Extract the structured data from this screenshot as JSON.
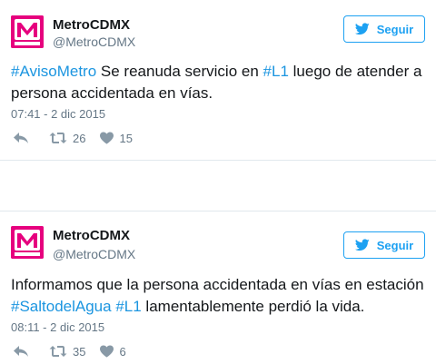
{
  "tweets": [
    {
      "name": "MetroCDMX",
      "handle": "@MetroCDMX",
      "follow_label": "Seguir",
      "text": [
        {
          "t": "#AvisoMetro",
          "tag": true
        },
        {
          "t": " Se reanuda servicio en ",
          "tag": false
        },
        {
          "t": "#L1",
          "tag": true
        },
        {
          "t": " luego de atender a persona accidentada en vías.",
          "tag": false
        }
      ],
      "time": "07:41 - 2 dic 2015",
      "retweets": "26",
      "likes": "15"
    },
    {
      "name": "MetroCDMX",
      "handle": "@MetroCDMX",
      "follow_label": "Seguir",
      "text": [
        {
          "t": "Informamos que la persona accidentada en vías en estación ",
          "tag": false
        },
        {
          "t": "#SaltodelAgua",
          "tag": true
        },
        {
          "t": " ",
          "tag": false
        },
        {
          "t": "#L1",
          "tag": true
        },
        {
          "t": " lamentablemente perdió la vida.",
          "tag": false
        }
      ],
      "time": "08:11 - 2 dic 2015",
      "retweets": "35",
      "likes": "6"
    }
  ],
  "colors": {
    "brand": "#e6007e",
    "link": "#1b95e0",
    "follow": "#1da1f2",
    "muted": "#657786"
  },
  "icons": [
    "metro-logo-icon",
    "twitter-bird-icon",
    "reply-icon",
    "retweet-icon",
    "heart-icon"
  ]
}
